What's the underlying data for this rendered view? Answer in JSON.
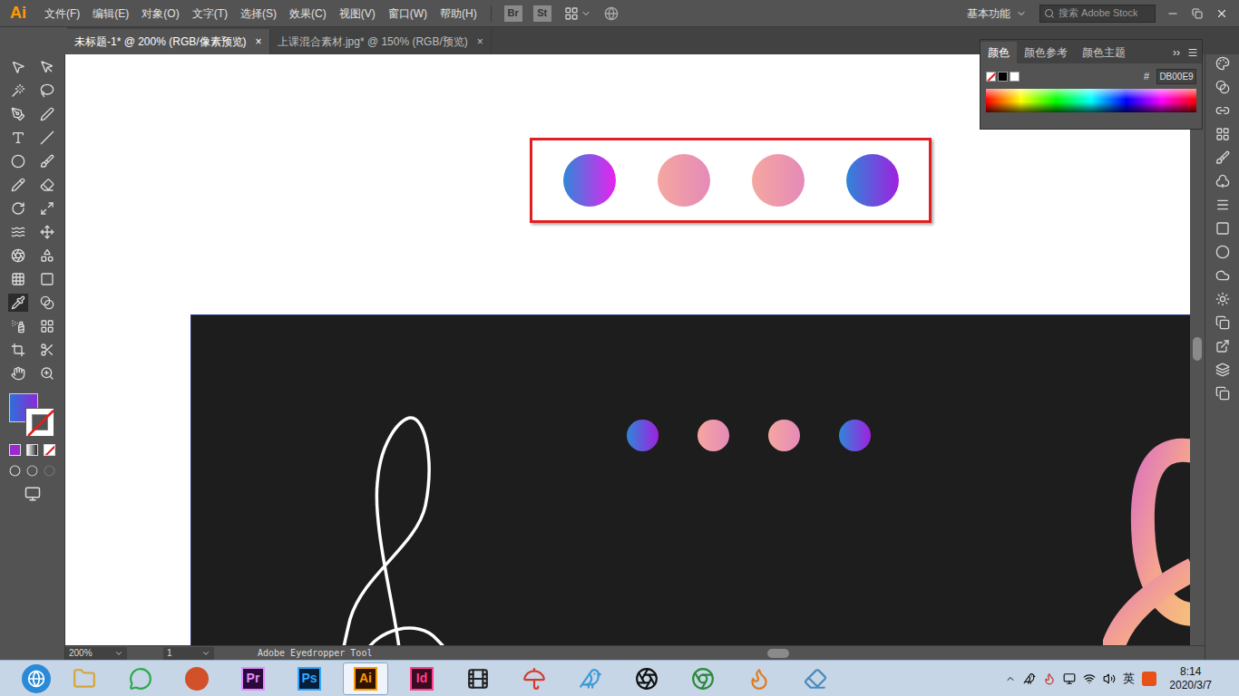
{
  "app_logo": "Ai",
  "menu": [
    "文件(F)",
    "编辑(E)",
    "对象(O)",
    "文字(T)",
    "选择(S)",
    "效果(C)",
    "视图(V)",
    "窗口(W)",
    "帮助(H)"
  ],
  "bridge_buttons": [
    "Br",
    "St"
  ],
  "workspace": "基本功能",
  "search": {
    "placeholder": "搜索 Adobe Stock"
  },
  "tabs": [
    {
      "label": "未标题-1* @ 200% (RGB/像素预览)",
      "selected": true,
      "close": "×"
    },
    {
      "label": "上课混合素材.jpg* @ 150% (RGB/预览)",
      "selected": false,
      "close": "×"
    }
  ],
  "toolbar": {
    "fill": {
      "color": "#2f6fd8",
      "color_end": "#8a2ad8"
    }
  },
  "color_panel": {
    "tabs": [
      {
        "label": "颜色",
        "selected": true
      },
      {
        "label": "颜色参考",
        "selected": false
      },
      {
        "label": "颜色主题",
        "selected": false
      }
    ],
    "more": "››",
    "hash": "#",
    "hex": "DB00E9"
  },
  "canvas": {
    "selection_color": "#e02020",
    "swatches": [
      {
        "color": "#2f86d8",
        "color_end": "#e822f0"
      },
      {
        "color": "#f5a7a0",
        "color_end": "#e58ab8"
      },
      {
        "color": "#f5a7a0",
        "color_end": "#e58ab8"
      },
      {
        "color": "#2f86d8",
        "color_end": "#a020e0"
      }
    ],
    "artboard_swatches": [
      {
        "color": "#2f86d8",
        "color_end": "#a020e0"
      },
      {
        "color": "#f5a7a0",
        "color_end": "#e58ab8"
      },
      {
        "color": "#f5a7a0",
        "color_end": "#e58ab8"
      },
      {
        "color": "#2f86d8",
        "color_end": "#a020e0"
      }
    ]
  },
  "status_bar": {
    "zoom": "200%",
    "page": "1",
    "tool": "Adobe Eyedropper Tool"
  },
  "taskbar": {
    "apps": [
      {
        "label": "Pr",
        "color": "#2a0a3a",
        "text_color": "#e58cff",
        "selected": false
      },
      {
        "label": "Ps",
        "color": "#061e3a",
        "text_color": "#31a8ff",
        "selected": false
      },
      {
        "label": "Ai",
        "color": "#2e1400",
        "text_color": "#ff9a00",
        "selected": true
      },
      {
        "label": "Id",
        "color": "#3a0a1e",
        "text_color": "#ff3f8e",
        "selected": false
      }
    ],
    "ime": "英",
    "time": "8:14",
    "date": "2020/3/7"
  }
}
